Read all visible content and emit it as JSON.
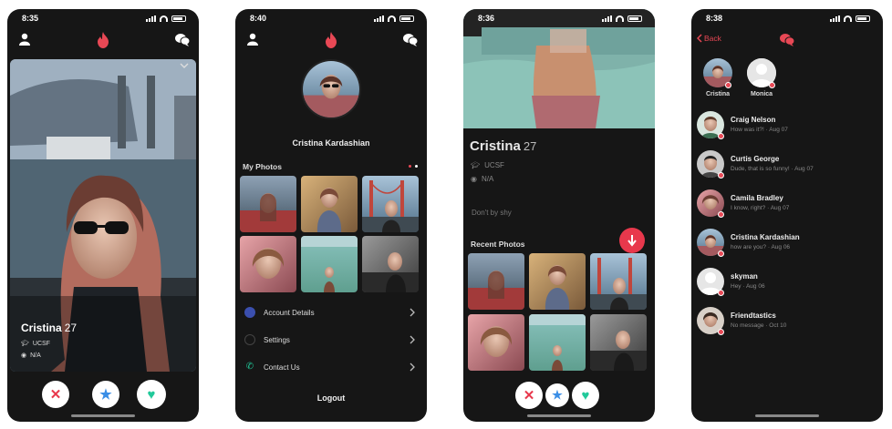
{
  "colors": {
    "accent": "#e84855",
    "background": "#161616",
    "card": "#222222",
    "star": "#3a8ee6",
    "heart": "#21c99a",
    "nope": "#e8384c"
  },
  "screens": [
    {
      "status": {
        "time": "8:35"
      },
      "card": {
        "name": "Cristina",
        "age": "27",
        "school": "UCSF",
        "location": "N/A"
      },
      "icons": {
        "left": "profile-icon",
        "center": "flame-icon",
        "right": "chat-bubbles-icon"
      },
      "actions": [
        {
          "icon": "close-icon",
          "glyph": "✕"
        },
        {
          "icon": "star-icon",
          "glyph": "★"
        },
        {
          "icon": "heart-icon",
          "glyph": "♥"
        }
      ]
    },
    {
      "status": {
        "time": "8:40"
      },
      "profile_name": "Cristina Kardashian",
      "photos_title": "My Photos",
      "menu": [
        {
          "label": "Account Details",
          "icon": "person-icon"
        },
        {
          "label": "Settings",
          "icon": "gear-icon"
        },
        {
          "label": "Contact Us",
          "icon": "phone-icon"
        }
      ],
      "logout": "Logout"
    },
    {
      "status": {
        "time": "8:36"
      },
      "name": "Cristina",
      "age": "27",
      "school": "UCSF",
      "location": "N/A",
      "bio": "Don't by shy",
      "recent_title": "Recent Photos"
    },
    {
      "status": {
        "time": "8:38"
      },
      "back": "Back",
      "matches": [
        {
          "name": "Cristina"
        },
        {
          "name": "Monica"
        }
      ],
      "conversations": [
        {
          "name": "Craig Nelson",
          "message": "How was it?! · Aug 07"
        },
        {
          "name": "Curtis George",
          "message": "Dude, that is so funny! · Aug 07"
        },
        {
          "name": "Camila Bradley",
          "message": "I know, right? · Aug 07"
        },
        {
          "name": "Cristina Kardashian",
          "message": "how are you? · Aug 06"
        },
        {
          "name": "skyman",
          "message": "Hey · Aug 06"
        },
        {
          "name": "Friendtastics",
          "message": "No message · Oct 10"
        }
      ]
    }
  ]
}
